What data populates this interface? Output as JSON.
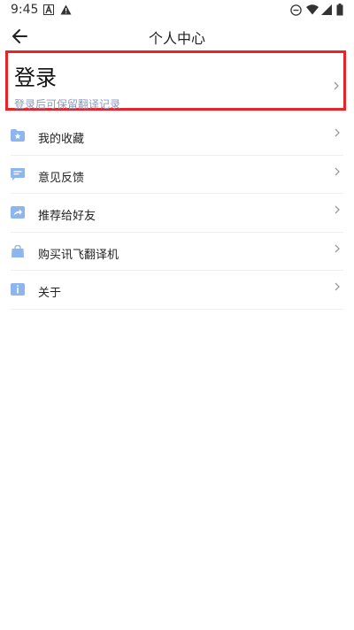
{
  "status_bar": {
    "time": "9:45",
    "icons": [
      "text-a-icon",
      "warning-icon",
      "do-not-disturb-icon",
      "wifi-icon",
      "signal-icon",
      "battery-icon"
    ]
  },
  "app_bar": {
    "title": "个人中心",
    "back_icon": "arrow-left-icon"
  },
  "login": {
    "title": "登录",
    "subtitle": "登录后可保留翻译记录",
    "highlight_color": "#e8232a"
  },
  "menu": {
    "icon_color": "#8db6ee",
    "items": [
      {
        "label": "我的收藏",
        "icon": "folder-star-icon"
      },
      {
        "label": "意见反馈",
        "icon": "feedback-chat-icon"
      },
      {
        "label": "推荐给好友",
        "icon": "share-icon"
      },
      {
        "label": "购买讯飞翻译机",
        "icon": "shopping-bag-icon"
      },
      {
        "label": "关于",
        "icon": "info-icon"
      }
    ]
  }
}
